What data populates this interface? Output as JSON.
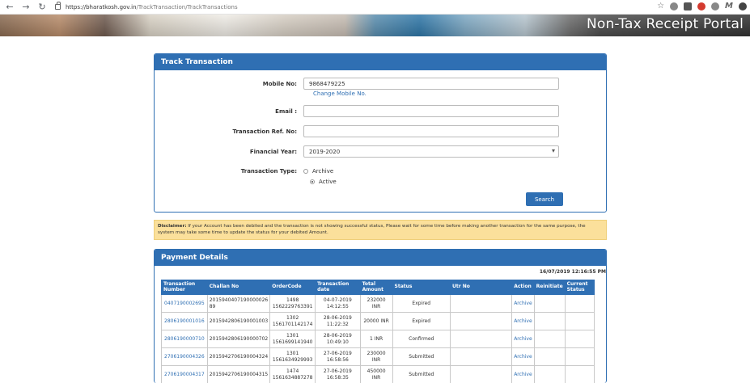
{
  "browser": {
    "url_host": "https://bharatkosh.gov.in",
    "url_path": "/TrackTransaction/TrackTransactions"
  },
  "banner": {
    "title": "Non-Tax Receipt Portal"
  },
  "track": {
    "header": "Track Transaction",
    "mobile_label": "Mobile No:",
    "mobile_value": "9868479225",
    "change_mobile_link": "Change Mobile No.",
    "email_label": "Email :",
    "email_value": "",
    "ref_label": "Transaction Ref. No:",
    "ref_value": "",
    "fy_label": "Financial Year:",
    "fy_value": "2019-2020",
    "type_label": "Transaction Type:",
    "type_options": [
      "Archive",
      "Active"
    ],
    "type_selected": "Active",
    "search_button": "Search"
  },
  "disclaimer": {
    "prefix": "Disclaimer:",
    "text": " If your Account has been debited and the transaction is not showing successful status, Please wait for some time before making another transaction for the same purpose, the system may take some time to update the status for your debited Amount."
  },
  "payment": {
    "header": "Payment Details",
    "timestamp": "16/07/2019 12:16:55 PM",
    "columns": [
      "Transaction Number",
      "Challan No",
      "OrderCode",
      "Transaction date",
      "Total Amount",
      "Status",
      "Utr No",
      "Action",
      "Reinitiate",
      "Current Status"
    ],
    "rows": [
      {
        "txn": "0407190002695",
        "challan": "2015940407190000026​89",
        "order1": "1498",
        "order2": "1562229763391",
        "date1": "04-07-2019",
        "date2": "14:12:55",
        "amount": "232000 INR",
        "status": "Expired",
        "utr": "",
        "action": "Archive"
      },
      {
        "txn": "2806190001016",
        "challan": "2015942806190001003",
        "order1": "1302",
        "order2": "1561701142174",
        "date1": "28-06-2019",
        "date2": "11:22:32",
        "amount": "20000 INR",
        "status": "Expired",
        "utr": "",
        "action": "Archive"
      },
      {
        "txn": "2806190000710",
        "challan": "2015942806190000702",
        "order1": "1301",
        "order2": "1561699141940",
        "date1": "28-06-2019",
        "date2": "10:49:10",
        "amount": "1 INR",
        "status": "Confirmed",
        "utr": "",
        "action": "Archive"
      },
      {
        "txn": "2706190004326",
        "challan": "2015942706190004324",
        "order1": "1301",
        "order2": "1561634929993",
        "date1": "27-06-2019",
        "date2": "16:58:56",
        "amount": "230000 INR",
        "status": "Submitted",
        "utr": "",
        "action": "Archive"
      },
      {
        "txn": "2706190004317",
        "challan": "2015942706190004315",
        "order1": "1474",
        "order2": "1561634887278",
        "date1": "27-06-2019",
        "date2": "16:58:35",
        "amount": "450000 INR",
        "status": "Submitted",
        "utr": "",
        "action": "Archive"
      }
    ]
  }
}
